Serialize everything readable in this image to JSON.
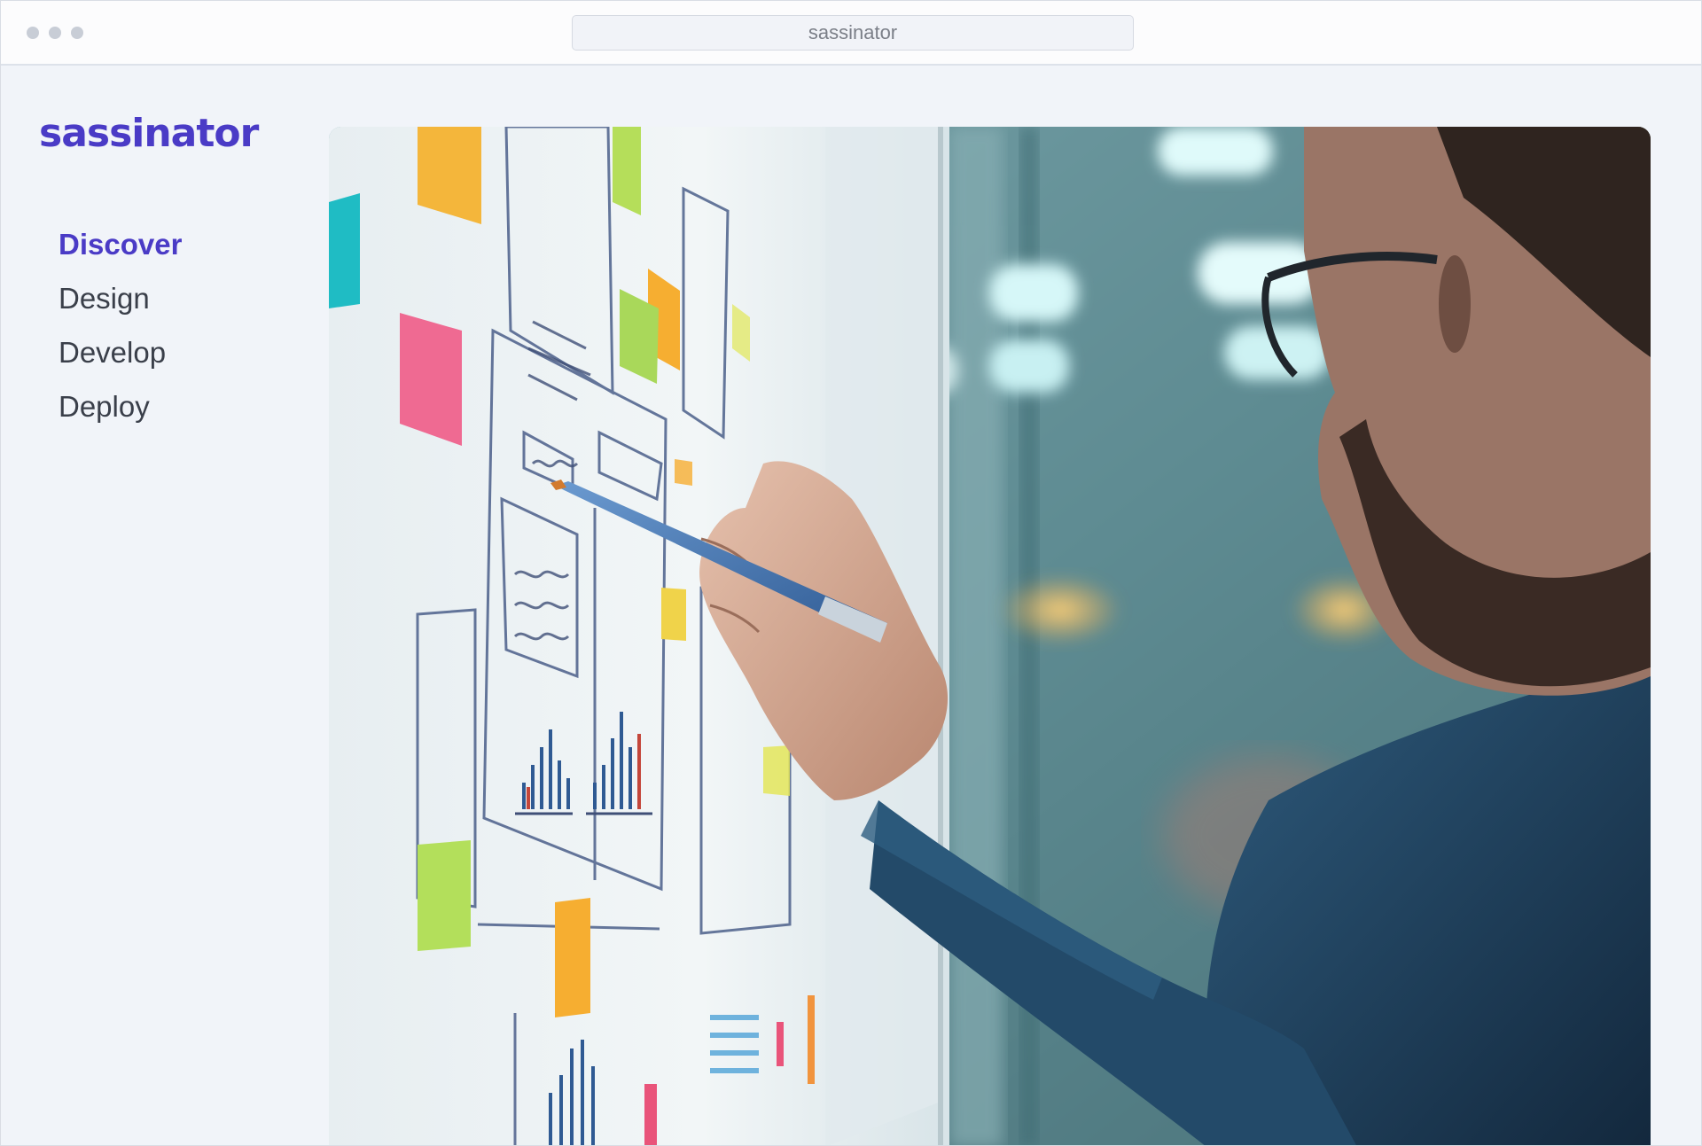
{
  "browser": {
    "address": "sassinator"
  },
  "sidebar": {
    "brand": "sassinator",
    "items": [
      {
        "label": "Discover",
        "active": true
      },
      {
        "label": "Design",
        "active": false
      },
      {
        "label": "Develop",
        "active": false
      },
      {
        "label": "Deploy",
        "active": false
      }
    ]
  },
  "hero": {
    "image": "person-writing-on-whiteboard-with-sticky-notes"
  },
  "colors": {
    "accent": "#4a3bc6",
    "nav_text": "#3a3f4a",
    "background": "#f1f4f9"
  }
}
